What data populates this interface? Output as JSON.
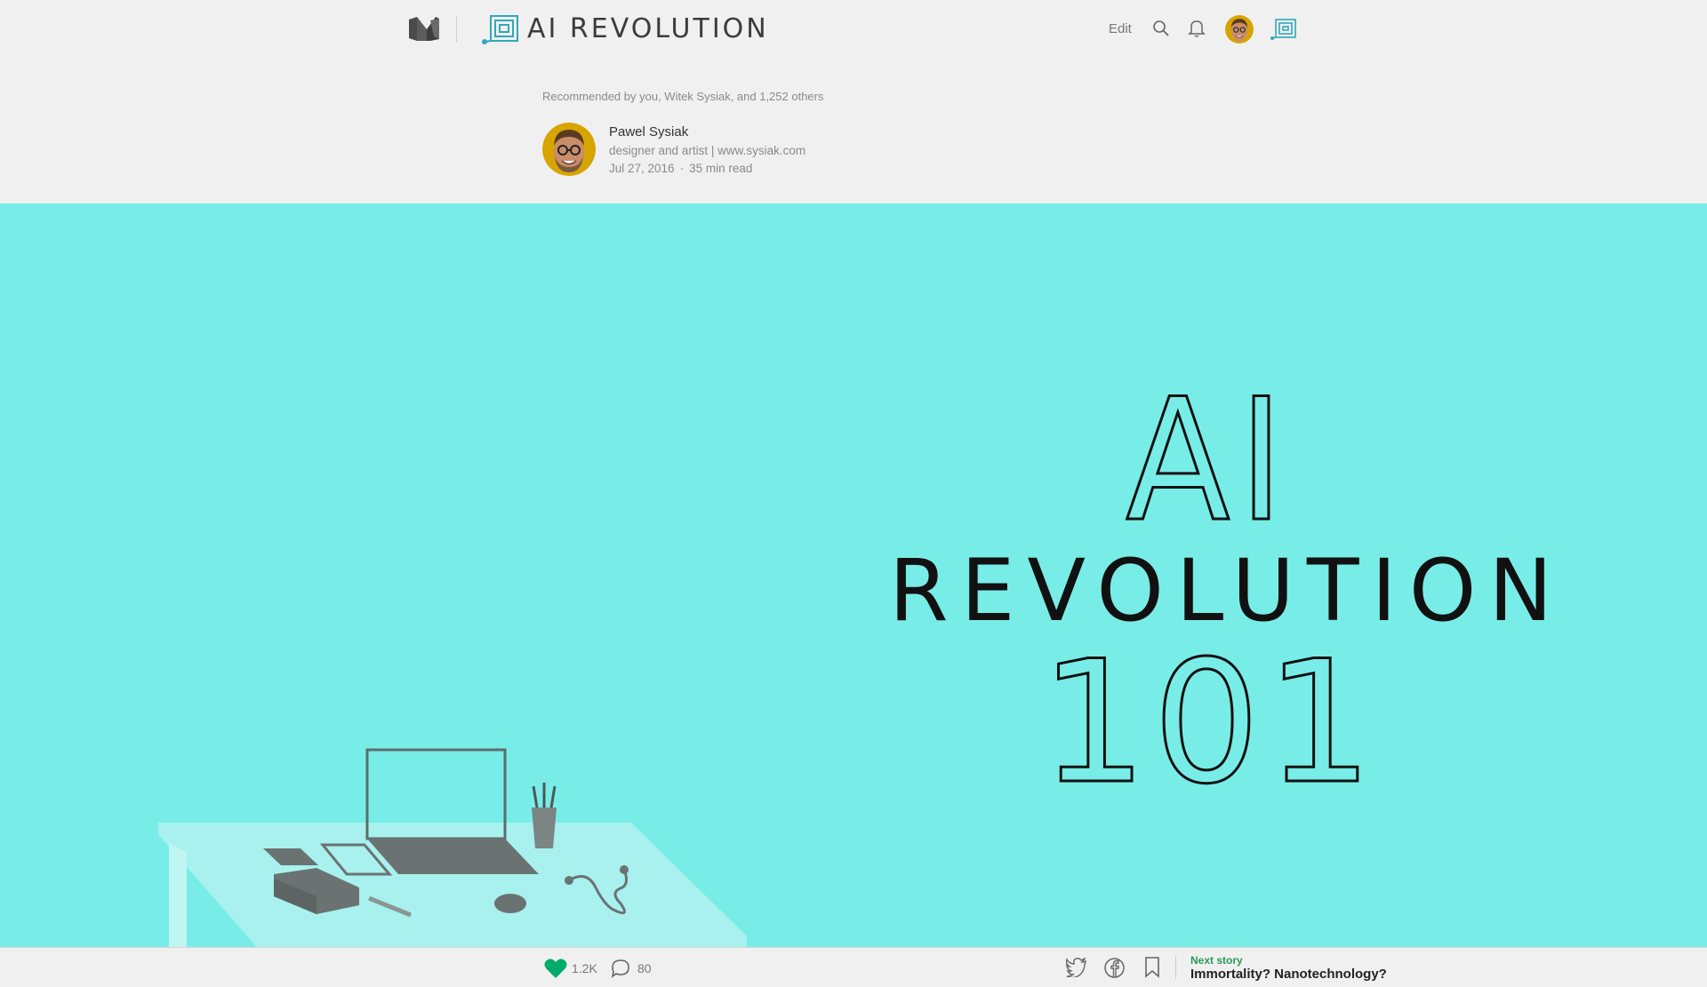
{
  "nav": {
    "publication_name": "AI REVOLUTION",
    "edit_label": "Edit",
    "icons": [
      "medium-logo",
      "publication-logo",
      "search-icon",
      "bell-icon",
      "avatar",
      "publication-icon"
    ]
  },
  "meta": {
    "recommended": "Recommended by you, Witek Sysiak, and 1,252 others",
    "author_name": "Pawel Sysiak",
    "author_bio": "designer and artist | www.sysiak.com",
    "date": "Jul 27, 2016",
    "separator": "·",
    "read_time": "35 min read"
  },
  "hero": {
    "line1": "AI",
    "line2": "REVOLUTION",
    "line3": "101",
    "background_color": "#78ede8"
  },
  "bottombar": {
    "like_count": "1.2K",
    "comment_count": "80",
    "next_label": "Next story",
    "next_title": "Immortality? Nanotechnology?",
    "like_color": "#00ab6b"
  }
}
